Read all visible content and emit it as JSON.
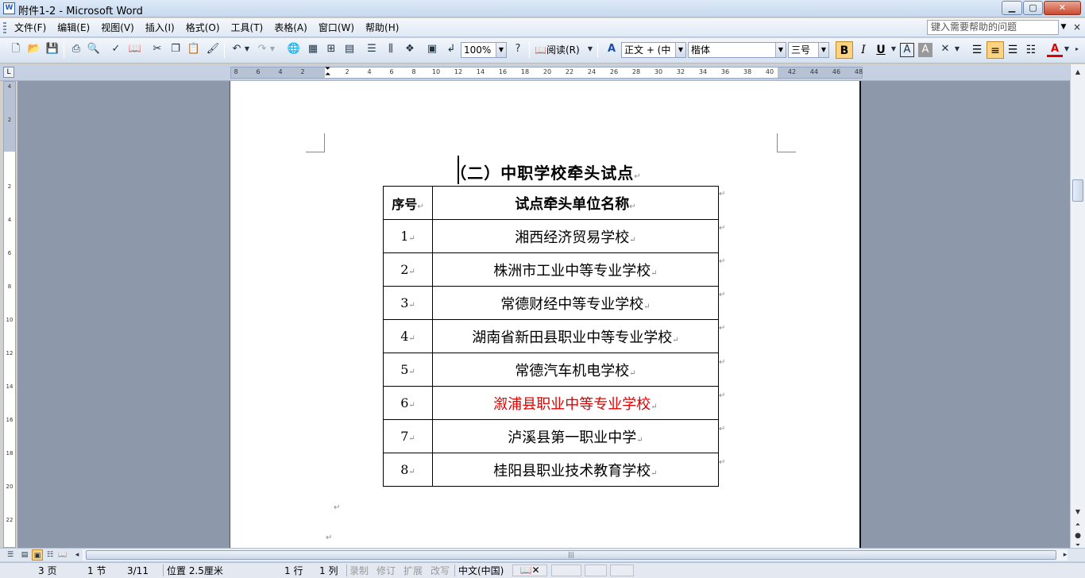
{
  "window": {
    "title": "附件1-2 - Microsoft Word",
    "app_icon": "W"
  },
  "menus": [
    "文件(F)",
    "编辑(E)",
    "视图(V)",
    "插入(I)",
    "格式(O)",
    "工具(T)",
    "表格(A)",
    "窗口(W)",
    "帮助(H)"
  ],
  "help_box": {
    "placeholder": "键入需要帮助的问题"
  },
  "toolbar": {
    "zoom": "100%",
    "reading_label": "阅读(R)",
    "style": "正文 + (中",
    "font": "楷体",
    "size": "三号",
    "bold": "B",
    "italic": "I",
    "underline": "U"
  },
  "ruler": {
    "ticks": [
      "8",
      "6",
      "4",
      "2",
      "2",
      "4",
      "6",
      "8",
      "10",
      "12",
      "14",
      "16",
      "18",
      "20",
      "22",
      "24",
      "26",
      "28",
      "30",
      "32",
      "34",
      "36",
      "38",
      "40",
      "42",
      "44",
      "46",
      "48"
    ]
  },
  "vruler": {
    "ticks": [
      "4",
      "2",
      "2",
      "4",
      "6",
      "8",
      "10",
      "12",
      "14",
      "16",
      "18",
      "20",
      "22"
    ]
  },
  "document": {
    "heading": "（二）中职学校牵头试点",
    "table": {
      "headers": [
        "序号",
        "试点牵头单位名称"
      ],
      "rows": [
        {
          "num": "1",
          "name": "湘西经济贸易学校"
        },
        {
          "num": "2",
          "name": "株洲市工业中等专业学校"
        },
        {
          "num": "3",
          "name": "常德财经中等专业学校"
        },
        {
          "num": "4",
          "name": "湖南省新田县职业中等专业学校"
        },
        {
          "num": "5",
          "name": "常德汽车机电学校"
        },
        {
          "num": "6",
          "name": "溆浦县职业中等专业学校"
        },
        {
          "num": "7",
          "name": "泸溪县第一职业中学"
        },
        {
          "num": "8",
          "name": "桂阳县职业技术教育学校"
        }
      ],
      "highlight_row": 6,
      "highlight_color": "#e00000"
    }
  },
  "status": {
    "page": "3 页",
    "section": "1 节",
    "pages": "3/11",
    "position": "位置 2.5厘米",
    "line": "1 行",
    "column": "1 列",
    "rec": "录制",
    "trk": "修订",
    "ext": "扩展",
    "ovr": "改写",
    "language": "中文(中国)"
  }
}
